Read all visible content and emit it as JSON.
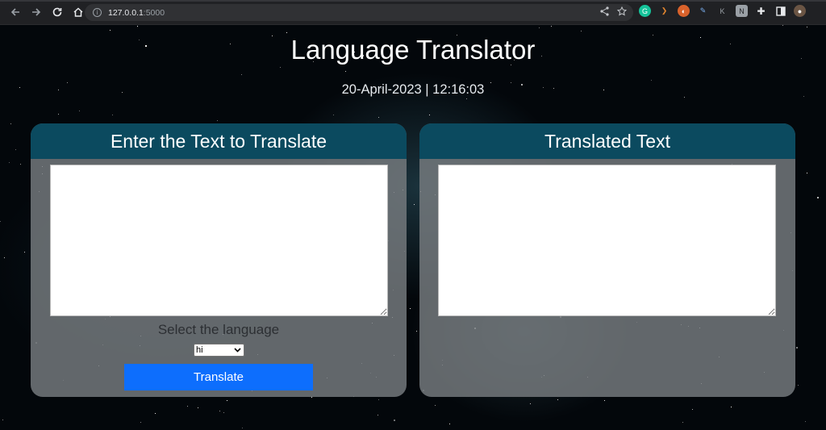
{
  "browser": {
    "url_host": "127.0.0.1",
    "url_port": ":5000"
  },
  "page": {
    "title": "Language Translator",
    "datetime": "20-April-2023 | 12:16:03"
  },
  "input_panel": {
    "heading": "Enter the Text to Translate",
    "textarea_value": "",
    "select_label": "Select the language",
    "selected_language": "hi",
    "button_label": "Translate"
  },
  "output_panel": {
    "heading": "Translated Text",
    "textarea_value": ""
  },
  "colors": {
    "panel_header": "#0b4a5f",
    "button": "#0d6efd"
  }
}
